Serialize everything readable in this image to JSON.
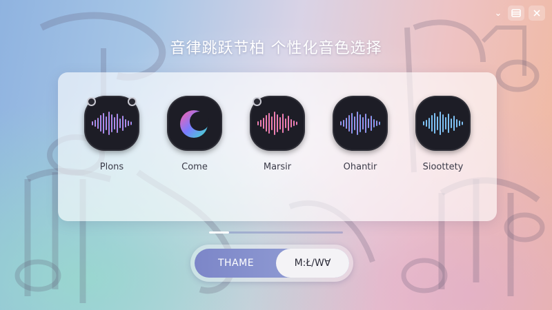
{
  "title": "音律跳跃节柏 个性化音色选择",
  "window_controls": [
    {
      "icon": "minimize-icon",
      "glyph": "⌄"
    },
    {
      "icon": "menu-icon"
    },
    {
      "icon": "close-icon"
    }
  ],
  "tiles": [
    {
      "label": "Plons",
      "icon": "waveform-icon",
      "colors": [
        "#ff6fb0",
        "#a77cff",
        "#5fd0ff"
      ]
    },
    {
      "label": "Come",
      "icon": "crescent-icon",
      "colors": [
        "#ff5fa8",
        "#7a7cff",
        "#3fe0c8"
      ]
    },
    {
      "label": "Marsir",
      "icon": "waveform-icon",
      "colors": [
        "#ffa46a",
        "#ff6fb0",
        "#b07cff"
      ]
    },
    {
      "label": "Ohantir",
      "icon": "waveform-icon",
      "colors": [
        "#ff6fb0",
        "#7a88ff",
        "#58d8ff"
      ]
    },
    {
      "label": "Sioottety",
      "icon": "waveform-icon",
      "colors": [
        "#7aa8ff",
        "#5fe0e8",
        "#c49cff"
      ]
    }
  ],
  "progress": {
    "value": 0.15
  },
  "toggle": {
    "left_label": "THAME",
    "right_label": "M:Ł/WⱯ",
    "selected": "right"
  }
}
